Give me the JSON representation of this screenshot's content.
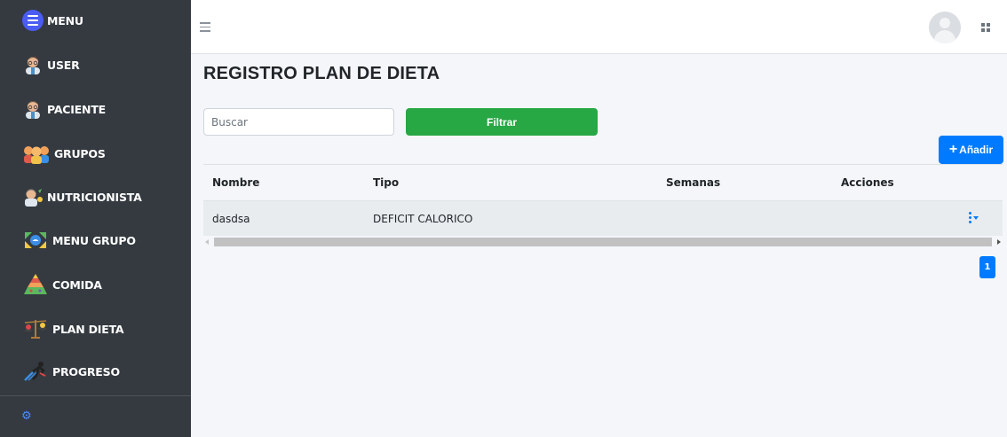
{
  "sidebar": {
    "items": [
      {
        "label": "MENU"
      },
      {
        "label": "USER"
      },
      {
        "label": "PACIENTE"
      },
      {
        "label": "GRUPOS"
      },
      {
        "label": "NUTRICIONISTA"
      },
      {
        "label": "MENU GRUPO"
      },
      {
        "label": "COMIDA"
      },
      {
        "label": "PLAN DIETA"
      },
      {
        "label": "PROGRESO"
      }
    ],
    "settings_icon": "gears-icon"
  },
  "topbar": {
    "menu_icon": "hamburger-icon",
    "user_icon": "user-avatar",
    "apps_icon": "grid-icon"
  },
  "page": {
    "title": "REGISTRO PLAN DE DIETA",
    "search_placeholder": "Buscar",
    "filter_label": "Filtrar",
    "add_label": "Añadir"
  },
  "table": {
    "headers": [
      "Nombre",
      "Tipo",
      "Semanas",
      "Acciones"
    ],
    "rows": [
      {
        "nombre": "dasdsa",
        "tipo": "DEFICIT CALORICO",
        "semanas": "",
        "acciones_icon": "more-vertical-icon"
      }
    ]
  },
  "pagination": {
    "current": "1"
  },
  "colors": {
    "sidebar_bg": "#343a40",
    "primary": "#007bff",
    "success": "#28a745",
    "menu_accent": "#4a5cf2"
  }
}
